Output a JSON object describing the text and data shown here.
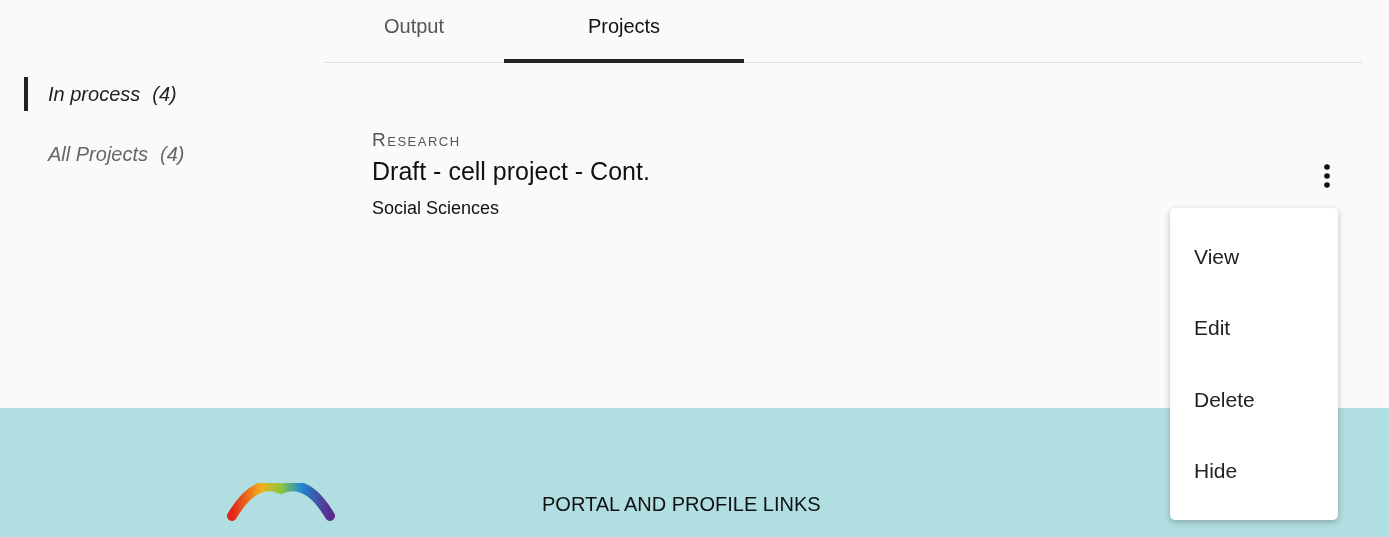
{
  "tabs": [
    {
      "label": "Output",
      "selected": false
    },
    {
      "label": "Projects",
      "selected": true
    }
  ],
  "sidebar": {
    "items": [
      {
        "label": "In process",
        "count": "(4)",
        "selected": true
      },
      {
        "label": "All Projects",
        "count": "(4)",
        "selected": false
      }
    ]
  },
  "project": {
    "category": "Research",
    "title": "Draft - cell project - Cont.",
    "field": "Social Sciences"
  },
  "menu": {
    "items": [
      "View",
      "Edit",
      "Delete",
      "Hide"
    ]
  },
  "footer": {
    "heading": "PORTAL AND PROFILE LINKS"
  }
}
